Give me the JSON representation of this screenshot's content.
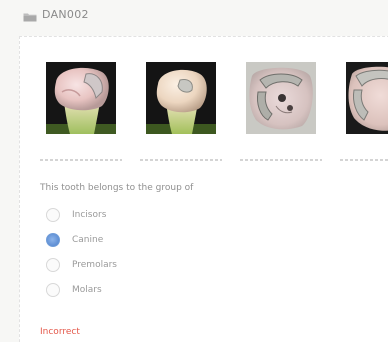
{
  "header": {
    "title": "DAN002",
    "icon": "folder-icon"
  },
  "images": [
    {
      "name": "tooth-image-1",
      "caption": ""
    },
    {
      "name": "tooth-image-2",
      "caption": ""
    },
    {
      "name": "tooth-image-3",
      "caption": ""
    },
    {
      "name": "tooth-image-4",
      "caption": ""
    }
  ],
  "question": {
    "text": "This tooth belongs to the group of"
  },
  "options": [
    {
      "label": "Incisors",
      "selected": false
    },
    {
      "label": "Canine",
      "selected": true
    },
    {
      "label": "Premolars",
      "selected": false
    },
    {
      "label": "Molars",
      "selected": false
    }
  ],
  "feedback": {
    "text": "Incorrect",
    "color": "#e4584a"
  },
  "colors": {
    "accent": "#5f8fd4",
    "error": "#e4584a"
  }
}
